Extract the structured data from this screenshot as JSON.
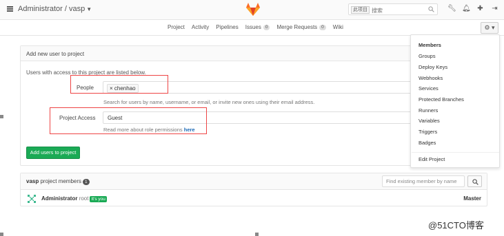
{
  "header": {
    "breadcrumb": "Administrator / vasp",
    "search_scope": "此项目",
    "search_placeholder": "搜索",
    "icons": [
      "wrench-icon",
      "bell-icon",
      "plus-icon",
      "sign-out-icon"
    ]
  },
  "subnav": {
    "items": [
      {
        "label": "Project",
        "count": null
      },
      {
        "label": "Activity",
        "count": null
      },
      {
        "label": "Pipelines",
        "count": null
      },
      {
        "label": "Issues",
        "count": "0"
      },
      {
        "label": "Merge Requests",
        "count": "0"
      },
      {
        "label": "Wiki",
        "count": null
      }
    ],
    "settings_icon": "gear-icon"
  },
  "add_user": {
    "heading": "Add new user to project",
    "intro": "Users with access to this project are listed below.",
    "people_label": "People",
    "people_token": "chenhao",
    "people_help": "Search for users by name, username, or email, or invite new ones using their email address.",
    "access_label": "Project Access",
    "access_value": "Guest",
    "access_help_text": "Read more about role permissions ",
    "access_help_link": "here",
    "submit_label": "Add users to project"
  },
  "members": {
    "project_name": "vasp",
    "title_suffix": " project members",
    "count": "1",
    "find_placeholder": "Find existing member by name",
    "rows": [
      {
        "name": "Administrator",
        "username": "root",
        "tag": "It's you",
        "role": "Master"
      }
    ]
  },
  "settings_menu": {
    "items": [
      "Members",
      "Groups",
      "Deploy Keys",
      "Webhooks",
      "Services",
      "Protected Branches",
      "Runners",
      "Variables",
      "Triggers",
      "Badges"
    ],
    "footer_item": "Edit Project",
    "active": "Members"
  },
  "watermark": "@51CTO博客",
  "colors": {
    "accent_green": "#1aaa55",
    "highlight_red": "#e44444",
    "link_blue": "#1b69b6",
    "logo_orange": "#e24329"
  }
}
